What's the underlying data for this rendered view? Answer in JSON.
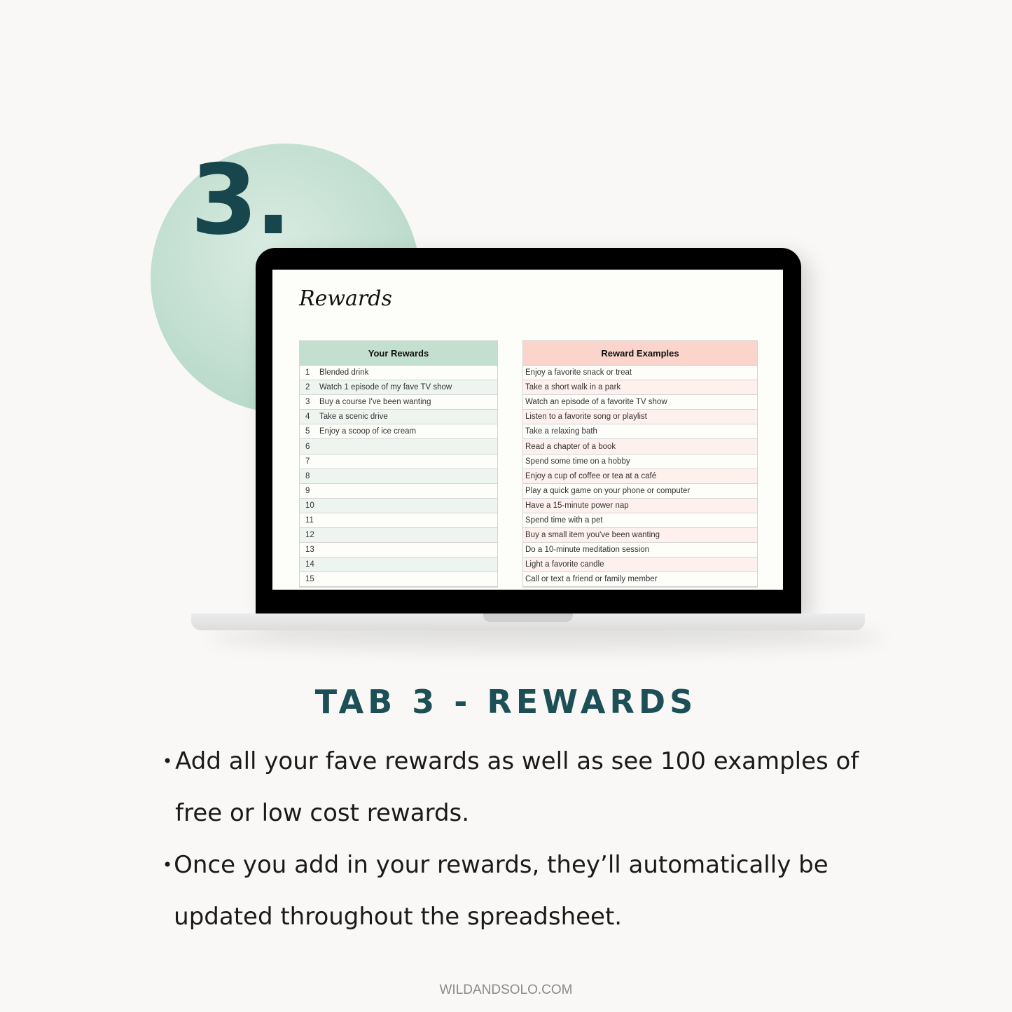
{
  "step_number": "3.",
  "sheet": {
    "title": "Rewards",
    "your_rewards": {
      "header": "Your Rewards",
      "rows": [
        {
          "n": "1",
          "text": "Blended drink"
        },
        {
          "n": "2",
          "text": "Watch 1 episode of my fave TV show"
        },
        {
          "n": "3",
          "text": "Buy a course I've been wanting"
        },
        {
          "n": "4",
          "text": "Take a scenic drive"
        },
        {
          "n": "5",
          "text": "Enjoy a scoop of ice cream"
        },
        {
          "n": "6",
          "text": ""
        },
        {
          "n": "7",
          "text": ""
        },
        {
          "n": "8",
          "text": ""
        },
        {
          "n": "9",
          "text": ""
        },
        {
          "n": "10",
          "text": ""
        },
        {
          "n": "11",
          "text": ""
        },
        {
          "n": "12",
          "text": ""
        },
        {
          "n": "13",
          "text": ""
        },
        {
          "n": "14",
          "text": ""
        },
        {
          "n": "15",
          "text": ""
        }
      ]
    },
    "reward_examples": {
      "header": "Reward Examples",
      "rows": [
        "Enjoy a favorite snack or treat",
        "Take a short walk in a park",
        "Watch an episode of a favorite TV show",
        "Listen to a favorite song or playlist",
        "Take a relaxing bath",
        "Read a chapter of a book",
        "Spend some time on a hobby",
        "Enjoy a cup of coffee or tea at a café",
        "Play a quick game on your phone or computer",
        "Have a 15-minute power nap",
        "Spend time with a pet",
        "Buy a small item you've been wanting",
        "Do a 10-minute meditation session",
        "Light a favorite candle",
        "Call or text a friend or family member"
      ]
    }
  },
  "heading": "TAB 3 - REWARDS",
  "bullets": [
    "Add all your fave rewards as well as see 100 examples of free or low cost rewards.",
    "Once you add in your rewards, they’ll automatically be updated throughout the spreadsheet."
  ],
  "footer": "WILDANDSOLO.COM",
  "colors": {
    "accent": "#1d4f57",
    "green_header": "#c3dfd0",
    "pink_header": "#fbd5cb"
  }
}
